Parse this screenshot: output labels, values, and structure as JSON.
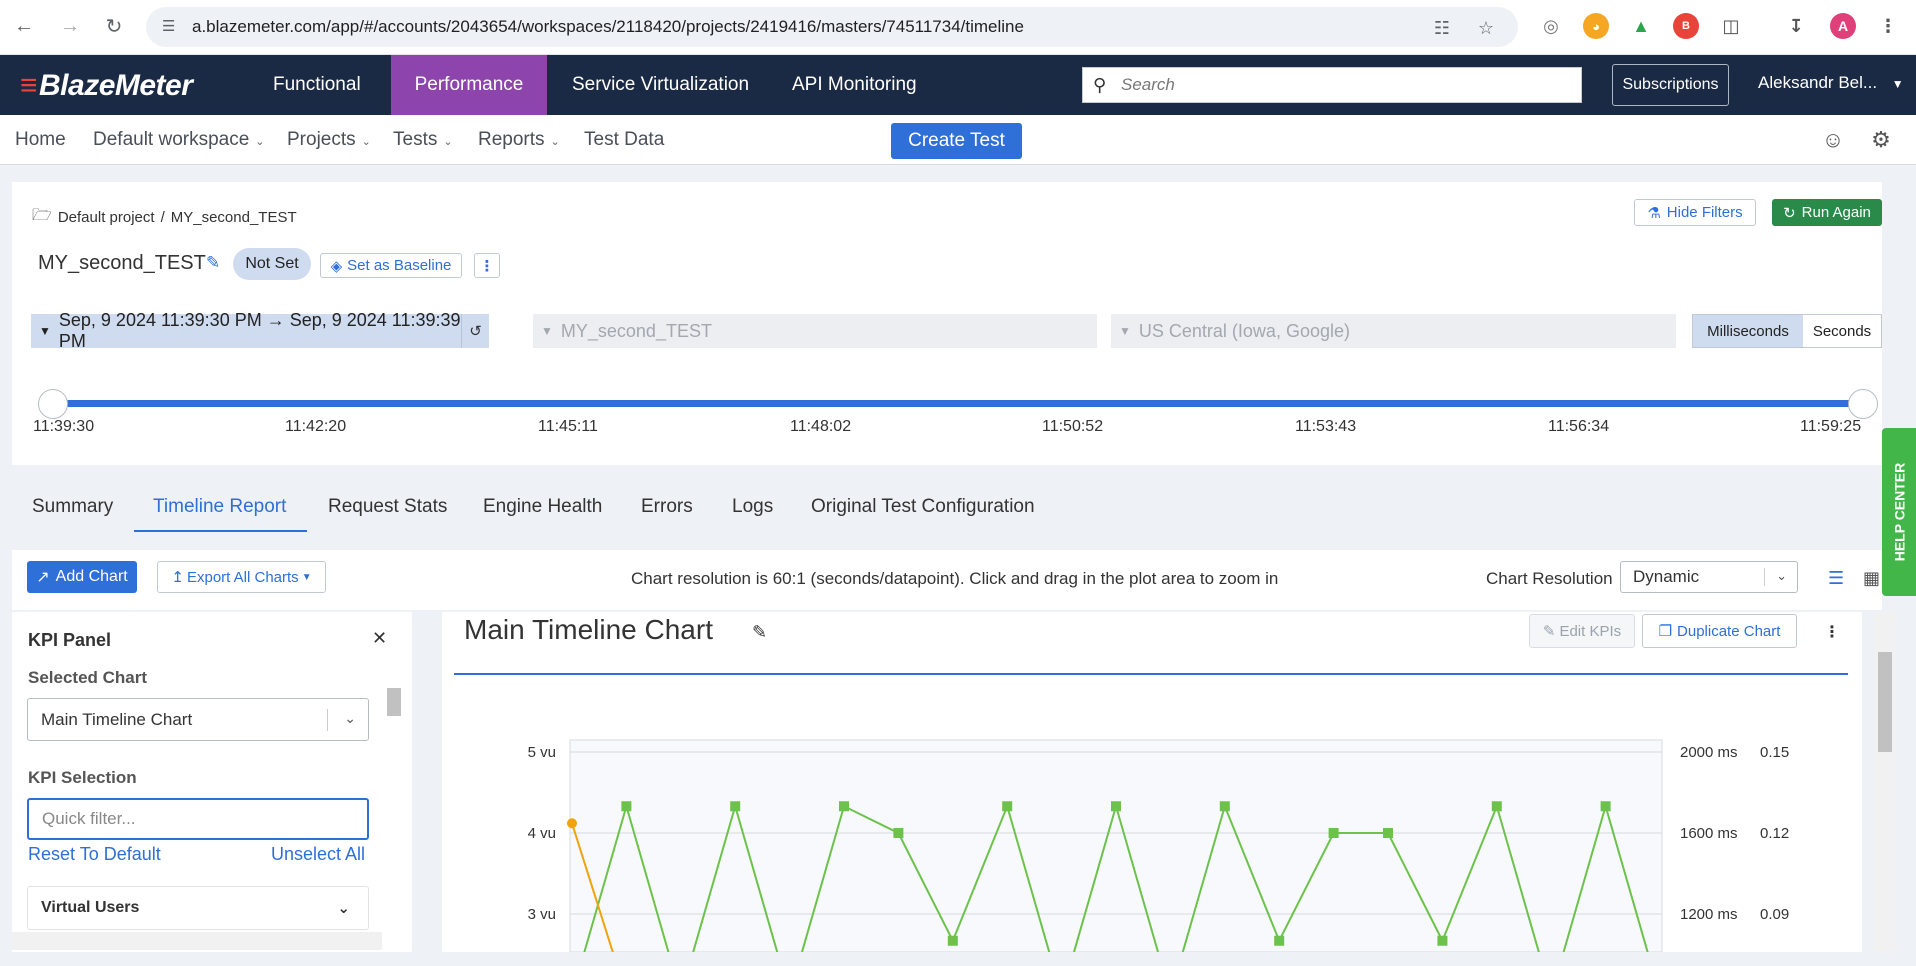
{
  "browser": {
    "url": "a.blazemeter.com/app/#/accounts/2043654/workspaces/2118420/projects/2419416/masters/74511734/timeline",
    "avatar_letter": "A"
  },
  "header": {
    "logo": "BlazeMeter",
    "nav": [
      "Functional",
      "Performance",
      "Service Virtualization",
      "API Monitoring"
    ],
    "active_nav": "Performance",
    "search_placeholder": "Search",
    "subscriptions": "Subscriptions",
    "user": "Aleksandr Bel..."
  },
  "subnav": {
    "items": [
      "Home",
      "Default workspace",
      "Projects",
      "Tests",
      "Reports",
      "Test Data"
    ],
    "create_test": "Create Test"
  },
  "test": {
    "breadcrumb_project": "Default project",
    "breadcrumb_sep": "/",
    "breadcrumb_test": "MY_second_TEST",
    "name": "MY_second_TEST",
    "status": "Not Set",
    "set_baseline": "Set as Baseline",
    "hide_filters": "Hide Filters",
    "run_again": "Run Again",
    "date_range": "Sep, 9 2024 11:39:30 PM → Sep, 9 2024 11:39:39 PM",
    "scenario_filter": "MY_second_TEST",
    "location_filter": "US Central (Iowa, Google)",
    "units": [
      "Milliseconds",
      "Seconds"
    ],
    "active_unit": "Milliseconds",
    "timeline_ticks": [
      "11:39:30",
      "11:42:20",
      "11:45:11",
      "11:48:02",
      "11:50:52",
      "11:53:43",
      "11:56:34",
      "11:59:25"
    ]
  },
  "tabs": [
    "Summary",
    "Timeline Report",
    "Request Stats",
    "Engine Health",
    "Errors",
    "Logs",
    "Original Test Configuration"
  ],
  "active_tab": "Timeline Report",
  "toolbar": {
    "add_chart": "Add Chart",
    "export": "Export All Charts",
    "resolution_note": "Chart resolution is 60:1 (seconds/datapoint). Click and drag in the plot area to zoom in",
    "resolution_label": "Chart Resolution",
    "resolution_value": "Dynamic"
  },
  "kpi_panel": {
    "title": "KPI Panel",
    "selected_chart_label": "Selected Chart",
    "selected_chart": "Main Timeline Chart",
    "kpi_selection_label": "KPI Selection",
    "filter_placeholder": "Quick filter...",
    "reset": "Reset To Default",
    "unselect": "Unselect All",
    "group": "Virtual Users"
  },
  "main_chart": {
    "title": "Main Timeline Chart",
    "edit_kpis": "Edit KPIs",
    "duplicate": "Duplicate Chart"
  },
  "help": "HELP CENTER",
  "chart_data": {
    "type": "line",
    "title": "Main Timeline Chart",
    "y_left_ticks": [
      "5 vu",
      "4 vu",
      "3 vu"
    ],
    "y_right1_ticks": [
      "2000 ms",
      "1600 ms",
      "1200 ms"
    ],
    "y_right2_ticks": [
      "0.15",
      "0.12",
      "0.09"
    ],
    "ylim_left": [
      2,
      5
    ],
    "series": [
      {
        "color": "#6cc24a",
        "points": [
          [
            0,
            2.0
          ],
          [
            1,
            4.33
          ],
          [
            2,
            2.0
          ],
          [
            3,
            4.33
          ],
          [
            4,
            2.0
          ],
          [
            5,
            4.33
          ],
          [
            6,
            4.0
          ],
          [
            7,
            2.67
          ],
          [
            8,
            4.33
          ],
          [
            9,
            2.0
          ],
          [
            10,
            4.33
          ],
          [
            11,
            2.0
          ],
          [
            12,
            4.33
          ],
          [
            13,
            2.67
          ],
          [
            14,
            4.0
          ],
          [
            15,
            4.0
          ],
          [
            16,
            2.67
          ],
          [
            17,
            4.33
          ],
          [
            18,
            2.0
          ],
          [
            19,
            4.33
          ],
          [
            20,
            2.0
          ]
        ]
      },
      {
        "color": "#f0a30a",
        "points": [
          [
            0,
            4.12
          ],
          [
            1,
            2.0
          ],
          [
            2,
            2.0
          ],
          [
            3,
            2.0
          ],
          [
            4,
            2.0
          ],
          [
            5,
            2.0
          ],
          [
            6,
            2.05
          ],
          [
            7,
            2.0
          ],
          [
            8,
            2.0
          ],
          [
            9,
            2.0
          ],
          [
            10,
            2.0
          ],
          [
            11,
            2.0
          ],
          [
            12,
            2.0
          ],
          [
            13,
            2.0
          ],
          [
            14,
            2.08
          ],
          [
            15,
            2.03
          ],
          [
            16,
            2.0
          ],
          [
            17,
            2.0
          ],
          [
            18,
            2.0
          ],
          [
            19,
            2.0
          ],
          [
            20,
            2.0
          ]
        ]
      }
    ]
  }
}
